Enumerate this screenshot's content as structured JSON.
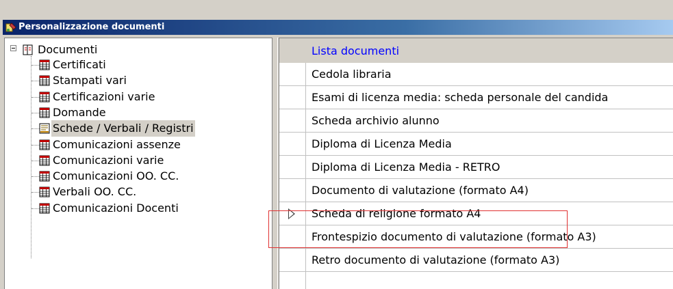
{
  "window": {
    "title": "Personalizzazione documenti"
  },
  "tree": {
    "root": {
      "label": "Documenti",
      "expanded": true
    },
    "items": [
      {
        "label": "Certificati",
        "selected": false
      },
      {
        "label": "Stampati vari",
        "selected": false
      },
      {
        "label": "Certificazioni varie",
        "selected": false
      },
      {
        "label": "Domande",
        "selected": false
      },
      {
        "label": "Schede / Verbali / Registri",
        "selected": true
      },
      {
        "label": "Comunicazioni assenze",
        "selected": false
      },
      {
        "label": "Comunicazioni varie",
        "selected": false
      },
      {
        "label": "Comunicazioni OO. CC.",
        "selected": false
      },
      {
        "label": "Verbali OO. CC.",
        "selected": false
      },
      {
        "label": "Comunicazioni Docenti",
        "selected": false
      }
    ]
  },
  "grid": {
    "header": "Lista documenti",
    "rows": [
      "Cedola libraria",
      "Esami di licenza media: scheda personale del candida",
      "Scheda archivio alunno",
      "Diploma di Licenza Media",
      "Diploma di Licenza Media - RETRO",
      "Documento di valutazione (formato A4)",
      "Scheda di religione formato A4",
      "Frontespizio documento di valutazione (formato A3)",
      "Retro documento di valutazione (formato A3)"
    ],
    "current_row_index": 6
  },
  "colors": {
    "header_text": "#0000ff",
    "highlight_border": "#e03030",
    "selection_bg": "#d4d0c8"
  }
}
